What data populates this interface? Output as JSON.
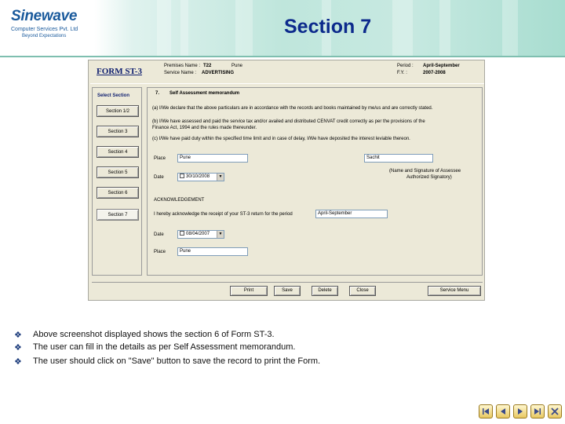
{
  "header": {
    "logo_name": "Sinewave",
    "logo_sub": "Computer Services Pvt. Ltd",
    "logo_tag": "Beyond Expectations",
    "slide_title": "Section 7"
  },
  "form": {
    "title": "FORM ST-3",
    "premises_label": "Premises Name :",
    "premises_value": "T22",
    "premises_extra": "Pune",
    "service_label": "Service Name :",
    "service_value": "ADVERTISING",
    "period_label": "Period :",
    "period_value": "April-September",
    "fy_label": "F.Y. :",
    "fy_value": "2007-2008",
    "select_section": "Select Section",
    "sections": [
      "Section 1/2",
      "Section 3",
      "Section 4",
      "Section 5",
      "Section 6",
      "Section 7"
    ],
    "active_section": "Section 7",
    "heading_num": "7.",
    "heading_text": "Self Assessment memorandum",
    "para_a": "(a) I/We declare that the above particulars are in accordance with the records and books maintained by me/us and are correctly stated.",
    "para_b1": "(b) I/We have assessed and paid the service tax and/or availed and distributed CENVAT credit correctly as per the provisions of the",
    "para_b2": "Finance Act, 1994 and the rules made thereunder.",
    "para_c": "(c) I/We have paid duty within the specified time limit and in case of delay, I/We have deposited the interest leviable thereon.",
    "place_label": "Place",
    "place_value": "Pune",
    "sign_value": "Sachit",
    "date_label": "Date",
    "date_value": "30/10/2008",
    "sign_caption1": "(Name and Signature of Assessee",
    "sign_caption2": "Authorized Signatory)",
    "ack_heading": "ACKNOWLEDGEMENT",
    "ack_text": "I hereby acknowledge the receipt of your ST-3 return for the period",
    "ack_period": "April-September",
    "ack_date_label": "Date",
    "ack_date_value": "08/04/2007",
    "ack_place_label": "Place",
    "ack_place_value": "Pune",
    "btn_print": "Print",
    "btn_save": "Save",
    "btn_delete": "Delete",
    "btn_close": "Close",
    "btn_menu": "Service Menu"
  },
  "bullets": [
    "Above screenshot displayed shows the section 6 of Form ST-3.",
    "The user can fill in the details as per Self Assessment memorandum.",
    "The user should click on \"Save\" button to save the record  to print the Form."
  ],
  "colors": {
    "title": "#0c2a8c",
    "header_bg": "#bfe6dc",
    "window_bg": "#ece9d8"
  },
  "nav_icons": [
    "first-icon",
    "prev-icon",
    "play-icon",
    "next-icon",
    "close-icon"
  ]
}
